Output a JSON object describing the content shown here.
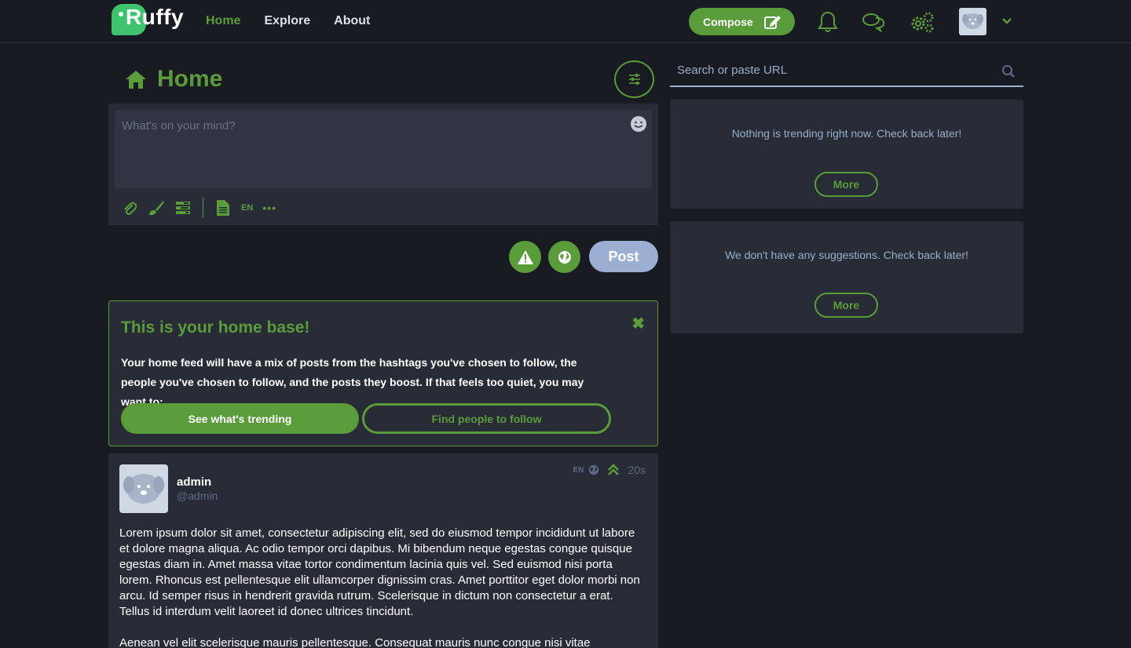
{
  "brand": {
    "name": "Ruffy",
    "accent": "#5b9c3a",
    "logo_color": "#3ec46d"
  },
  "nav": {
    "items": [
      {
        "label": "Home",
        "active": true
      },
      {
        "label": "Explore",
        "active": false
      },
      {
        "label": "About",
        "active": false
      }
    ]
  },
  "topbar": {
    "compose_label": "Compose",
    "icons": [
      "bell-icon",
      "chat-bubbles-icon",
      "settings-cogs-icon",
      "avatar",
      "chevron-down-icon"
    ]
  },
  "column": {
    "title": "Home"
  },
  "composer": {
    "placeholder": "What's on your mind?",
    "language": "EN",
    "tools": [
      "paperclip-icon",
      "paintbrush-icon",
      "poll-icon",
      "document-icon",
      "language-EN",
      "more-dots-icon"
    ],
    "post_label": "Post"
  },
  "homebase": {
    "title": "This is your home base!",
    "text": "Your home feed will have a mix of posts from the hashtags you've chosen to follow, the people you've chosen to follow, and the posts they boost. If that feels too quiet, you may want to:",
    "primary_label": "See what's trending",
    "secondary_label": "Find people to follow"
  },
  "status": {
    "display_name": "admin",
    "handle": "@admin",
    "language": "EN",
    "time": "20s",
    "paragraphs": [
      "Lorem ipsum dolor sit amet, consectetur adipiscing elit, sed do eiusmod tempor incididunt ut labore et dolore magna aliqua. Ac odio tempor orci dapibus. Mi bibendum neque egestas congue quisque egestas diam in. Amet massa vitae tortor condimentum lacinia quis vel. Sed euismod nisi porta lorem. Rhoncus est pellentesque elit ullamcorper dignissim cras. Amet porttitor eget dolor morbi non arcu. Id semper risus in hendrerit gravida rutrum. Scelerisque in dictum non consectetur a erat. Tellus id interdum velit laoreet id donec ultrices tincidunt.",
      "Aenean vel elit scelerisque mauris pellentesque. Consequat mauris nunc congue nisi vitae"
    ]
  },
  "sidebar": {
    "search_placeholder": "Search or paste URL",
    "trending_empty": "Nothing is trending right now. Check back later!",
    "suggestions_empty": "We don't have any suggestions. Check back later!",
    "more_label": "More"
  }
}
